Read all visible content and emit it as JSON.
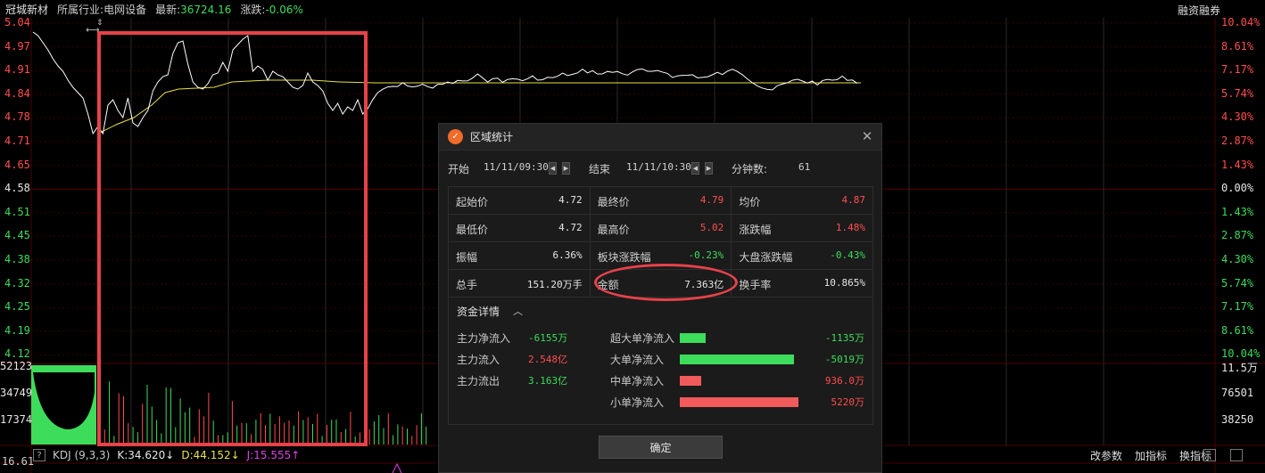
{
  "header": {
    "stock_name": "冠城新材",
    "industry_label": "所属行业:",
    "industry_value": "电网设备",
    "latest_label": "最新:",
    "latest_value": "36724.16",
    "change_label": "涨跌:",
    "change_value": "-0.06%",
    "margin_label": "融资融券"
  },
  "price_axis": {
    "left": [
      "5.04",
      "4.97",
      "4.91",
      "4.84",
      "4.78",
      "4.71",
      "4.65",
      "4.58",
      "4.51",
      "4.45",
      "4.38",
      "4.32",
      "4.25",
      "4.19",
      "4.12"
    ],
    "right": [
      "10.04%",
      "8.61%",
      "7.17%",
      "5.74%",
      "4.30%",
      "2.87%",
      "1.43%",
      "0.00%",
      "1.43%",
      "2.87%",
      "4.30%",
      "5.74%",
      "7.17%",
      "8.61%",
      "10.04%"
    ]
  },
  "volume_axis": {
    "left": [
      "52123",
      "34749",
      "17374"
    ],
    "right": [
      "11.5万",
      "76501",
      "38250"
    ]
  },
  "bottom_low_label": "16.61",
  "kdj": {
    "help": "?",
    "name": "KDJ (9,3,3)",
    "k": "K:34.620↓",
    "d": "D:44.152↓",
    "j": "J:15.555↑",
    "buttons": [
      "改参数",
      "加指标",
      "换指标"
    ]
  },
  "dialog": {
    "title": "区域统计",
    "close": "✕",
    "start_label": "开始",
    "start_value": "11/11/09:30",
    "end_label": "结束",
    "end_value": "11/11/10:30",
    "minutes_label": "分钟数:",
    "minutes_value": "61",
    "stats": [
      {
        "label": "起始价",
        "value": "4.72",
        "color": "#e6e6e6"
      },
      {
        "label": "最终价",
        "value": "4.79",
        "color": "#ff4d4d"
      },
      {
        "label": "均价",
        "value": "4.87",
        "color": "#ff4d4d"
      },
      {
        "label": "最低价",
        "value": "4.72",
        "color": "#e6e6e6"
      },
      {
        "label": "最高价",
        "value": "5.02",
        "color": "#ff4d4d"
      },
      {
        "label": "涨跌幅",
        "value": "1.48%",
        "color": "#ff4d4d"
      },
      {
        "label": "振幅",
        "value": "6.36%",
        "color": "#e6e6e6"
      },
      {
        "label": "板块涨跌幅",
        "value": "-0.23%",
        "color": "#3ddc5a"
      },
      {
        "label": "大盘涨跌幅",
        "value": "-0.43%",
        "color": "#3ddc5a"
      },
      {
        "label": "总手",
        "value": "151.20万手",
        "color": "#e6e6e6"
      },
      {
        "label": "金额",
        "value": "7.363亿",
        "color": "#e6e6e6"
      },
      {
        "label": "换手率",
        "value": "10.865%",
        "color": "#e6e6e6"
      }
    ],
    "funds_title": "资金详情",
    "funds_left": [
      {
        "label": "主力净流入",
        "value": "-6155万",
        "color": "#3ddc5a"
      },
      {
        "label": "主力流入",
        "value": "2.548亿",
        "color": "#ff4d4d"
      },
      {
        "label": "主力流出",
        "value": "3.163亿",
        "color": "#3ddc5a"
      }
    ],
    "funds_right": [
      {
        "label": "超大单净流入",
        "value": "-1135万",
        "color": "#3ddc5a",
        "bar_color": "#3ddc5a",
        "bar_level": 0.22
      },
      {
        "label": "大单净流入",
        "value": "-5019万",
        "color": "#3ddc5a",
        "bar_color": "#3ddc5a",
        "bar_level": 0.96
      },
      {
        "label": "中单净流入",
        "value": "936.0万",
        "color": "#ff4d4d",
        "bar_color": "#f05a5a",
        "bar_level": 0.18
      },
      {
        "label": "小单净流入",
        "value": "5220万",
        "color": "#ff4d4d",
        "bar_color": "#f05a5a",
        "bar_level": 1.0
      }
    ],
    "ok": "确定"
  },
  "colors": {
    "price_line": "#ffffff",
    "avg_line": "#e8e04a",
    "highlight": "#e8424a",
    "grid": "#3a0000",
    "vgrid": "#2a2a2a"
  }
}
